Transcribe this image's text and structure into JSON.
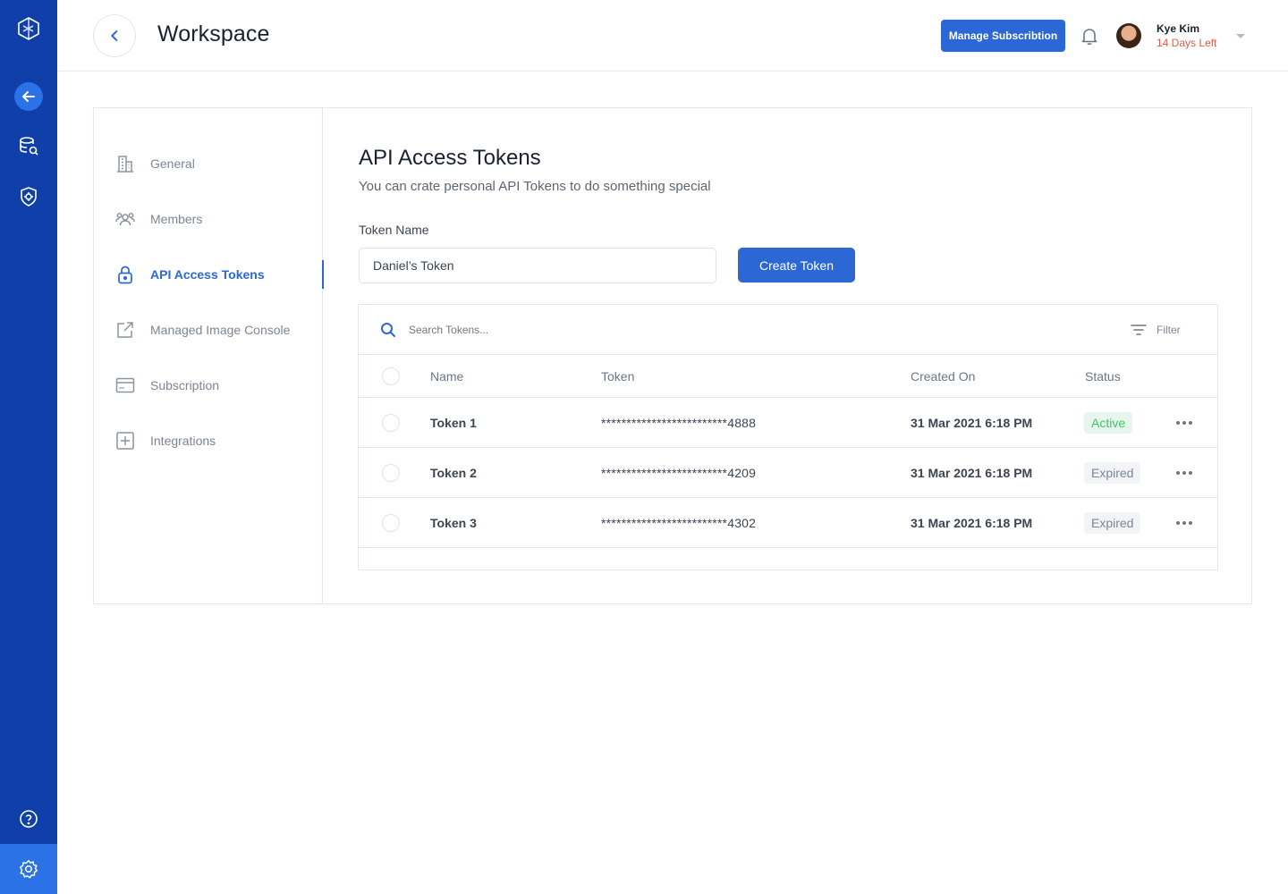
{
  "header": {
    "title": "Workspace",
    "manage_label": "Manage Subscribtion",
    "user_name": "Kye Kim",
    "user_sub": "14 Days Left"
  },
  "sidebar": {
    "items": [
      {
        "label": "General",
        "icon": "building-icon"
      },
      {
        "label": "Members",
        "icon": "members-icon"
      },
      {
        "label": "API Access Tokens",
        "icon": "lock-icon"
      },
      {
        "label": "Managed Image Console",
        "icon": "external-link-icon"
      },
      {
        "label": "Subscription",
        "icon": "card-icon"
      },
      {
        "label": "Integrations",
        "icon": "plus-square-icon"
      }
    ]
  },
  "main": {
    "title": "API Access Tokens",
    "description": "You can crate personal API Tokens to do something special",
    "token_label": "Token Name",
    "token_value": "Daniel’s Token",
    "create_label": "Create Token",
    "search_placeholder": "Search Tokens...",
    "filter_label": "Filter"
  },
  "table": {
    "headers": [
      "Name",
      "Token",
      "Created On",
      "Status"
    ],
    "rows": [
      {
        "name": "Token 1",
        "token": "*************************4888",
        "created": "31 Mar 2021 6:18 PM",
        "status": "Active"
      },
      {
        "name": "Token 2",
        "token": "*************************4209",
        "created": "31 Mar 2021 6:18 PM",
        "status": "Expired"
      },
      {
        "name": "Token 3",
        "token": "*************************4302",
        "created": "31 Mar 2021 6:18 PM",
        "status": "Expired"
      }
    ]
  },
  "colors": {
    "rail": "#0f3fa8",
    "accent": "#2b68d6",
    "active_status": "#3ec46a",
    "days_left": "#e85848"
  }
}
